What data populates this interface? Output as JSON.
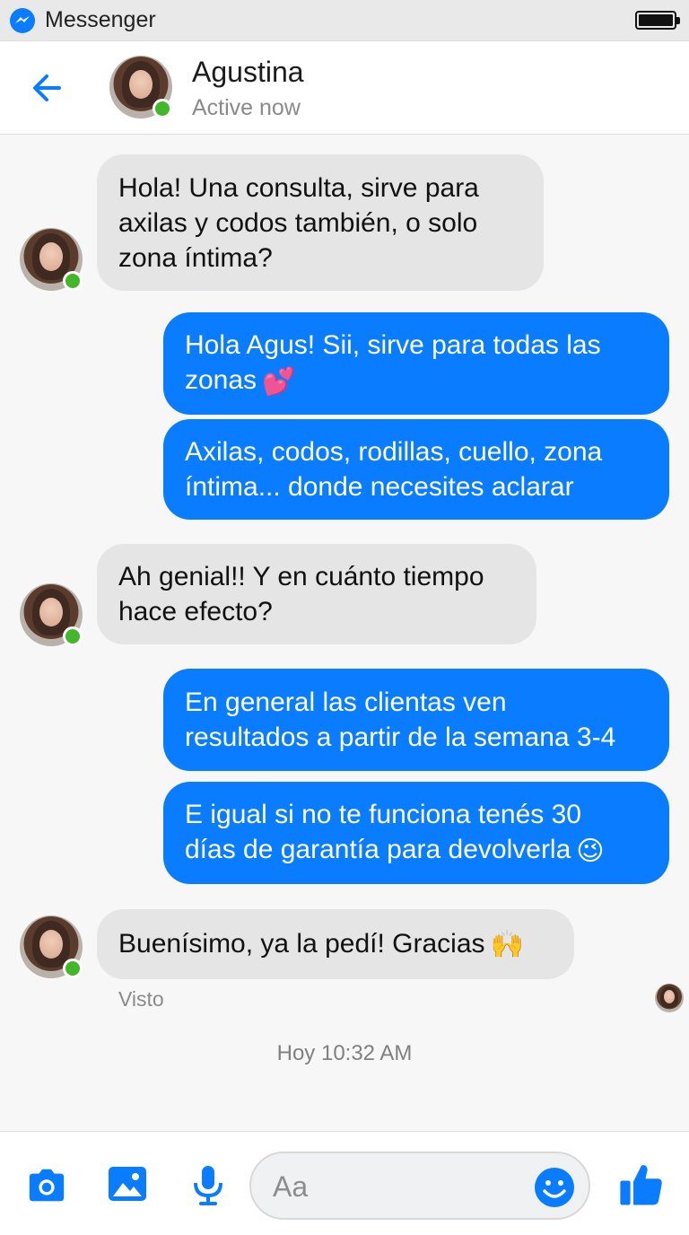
{
  "status_bar": {
    "app_name": "Messenger",
    "battery_icon": "battery-full-icon"
  },
  "header": {
    "contact_name": "Agustina",
    "status": "Active now",
    "back_icon": "arrow-left-icon"
  },
  "messages": [
    {
      "direction": "incoming",
      "text_lines": [
        "Hola! Una consulta, sirve para",
        "axilas y codos también, o solo",
        "zona íntima?"
      ]
    },
    {
      "direction": "outgoing",
      "text_lines": [
        "Hola Agus! Sii, sirve para todas las",
        "zonas"
      ],
      "emoji": "💕"
    },
    {
      "direction": "outgoing",
      "text_lines": [
        "Axilas, codos, rodillas, cuello, zona",
        "íntima... donde necesites aclarar"
      ]
    },
    {
      "direction": "incoming",
      "text_lines": [
        "Ah genial!! Y en cuánto tiempo",
        "hace efecto?"
      ]
    },
    {
      "direction": "outgoing",
      "text_lines": [
        "En general las clientas ven",
        "resultados a partir de la semana 3-4"
      ]
    },
    {
      "direction": "outgoing",
      "text_lines": [
        "E igual si no te funciona tenés 30",
        "días de garantía para devolverla"
      ],
      "emoji": "😉"
    },
    {
      "direction": "incoming",
      "text_lines": [
        "Buenísimo, ya la pedí! Gracias"
      ],
      "emoji": "🙌"
    }
  ],
  "seen_label": "Visto",
  "timestamp": "Hoy 10:32 AM",
  "composer": {
    "placeholder": "Aa",
    "icons": [
      "camera-icon",
      "image-icon",
      "microphone-icon",
      "emoji-icon",
      "thumbs-up-icon"
    ]
  },
  "colors": {
    "outgoing_bubble": "#0a7cff",
    "incoming_bubble": "#e5e5e5",
    "accent": "#0a7cff",
    "online": "#42b72a"
  }
}
